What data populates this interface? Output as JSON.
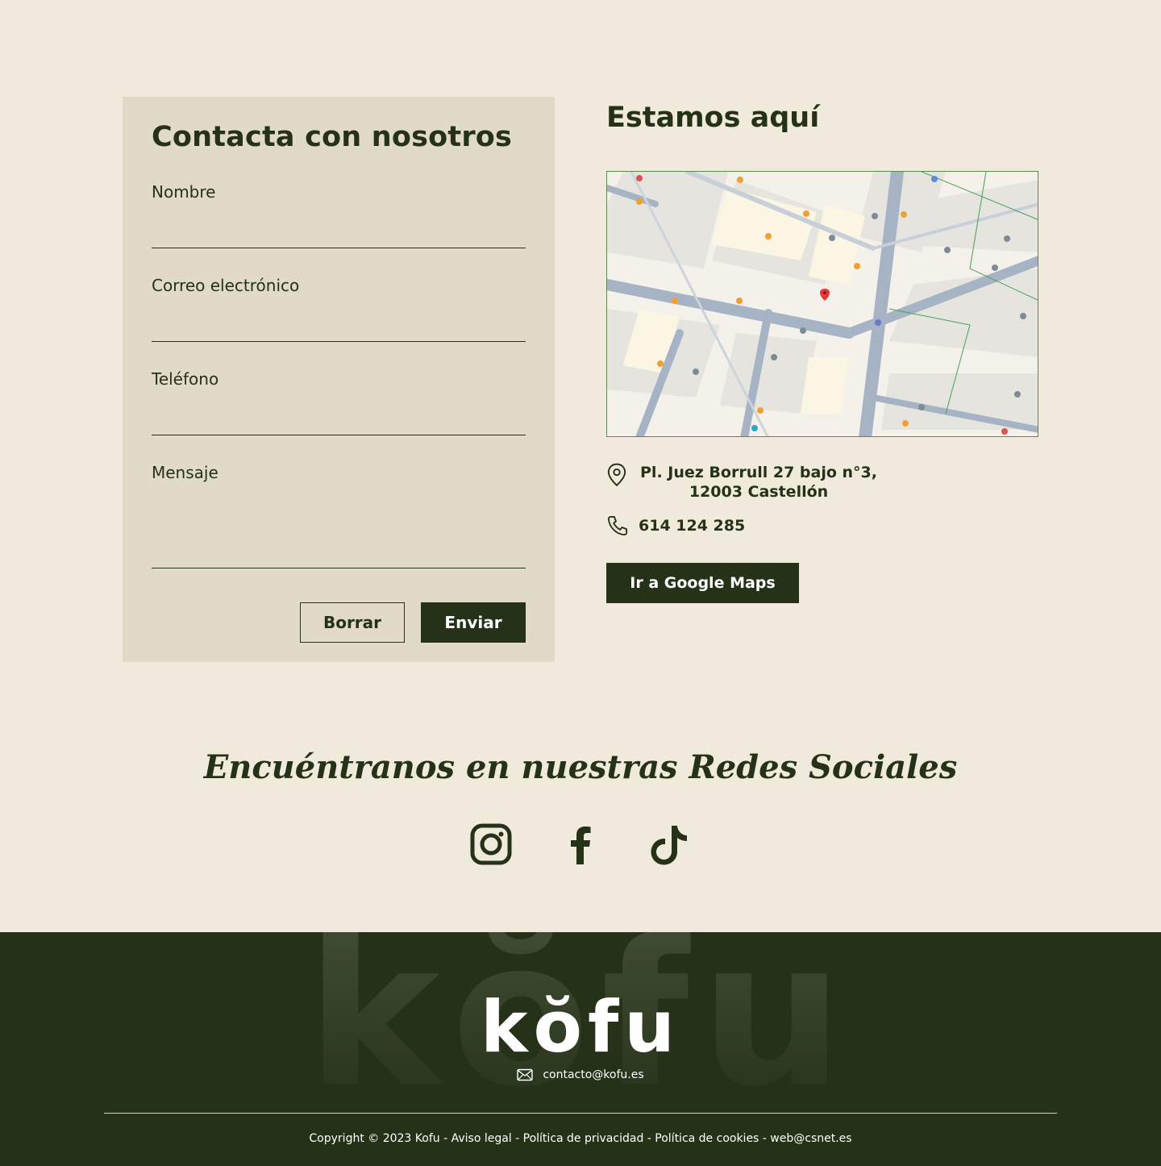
{
  "contact_form": {
    "title": "Contacta con nosotros",
    "fields": [
      {
        "label": "Nombre",
        "value": ""
      },
      {
        "label": "Correo electrónico",
        "value": ""
      },
      {
        "label": "Teléfono",
        "value": ""
      },
      {
        "label": "Mensaje",
        "value": ""
      }
    ],
    "reset_label": "Borrar",
    "submit_label": "Enviar"
  },
  "location": {
    "title": "Estamos aquí",
    "address_line1": "Pl. Juez Borrull 27 bajo n°3,",
    "address_line2": "12003 Castellón",
    "phone": "614 124 285",
    "maps_button": "Ir a Google Maps",
    "icons": [
      "location-pin-icon",
      "phone-icon"
    ]
  },
  "social": {
    "title": "Encuéntranos en nuestras Redes Sociales",
    "networks": [
      "instagram-icon",
      "facebook-icon",
      "tiktok-icon"
    ]
  },
  "footer": {
    "logo": "kŏfu",
    "email": "contacto@kofu.es",
    "copyright": "Copyright © 2023 Kofu - Aviso legal - Política de privacidad - Política de cookies - web@csnet.es"
  },
  "colors": {
    "background": "#f0eadc",
    "card": "#e0dac6",
    "primary": "#263218",
    "text_light": "#ffffff"
  }
}
